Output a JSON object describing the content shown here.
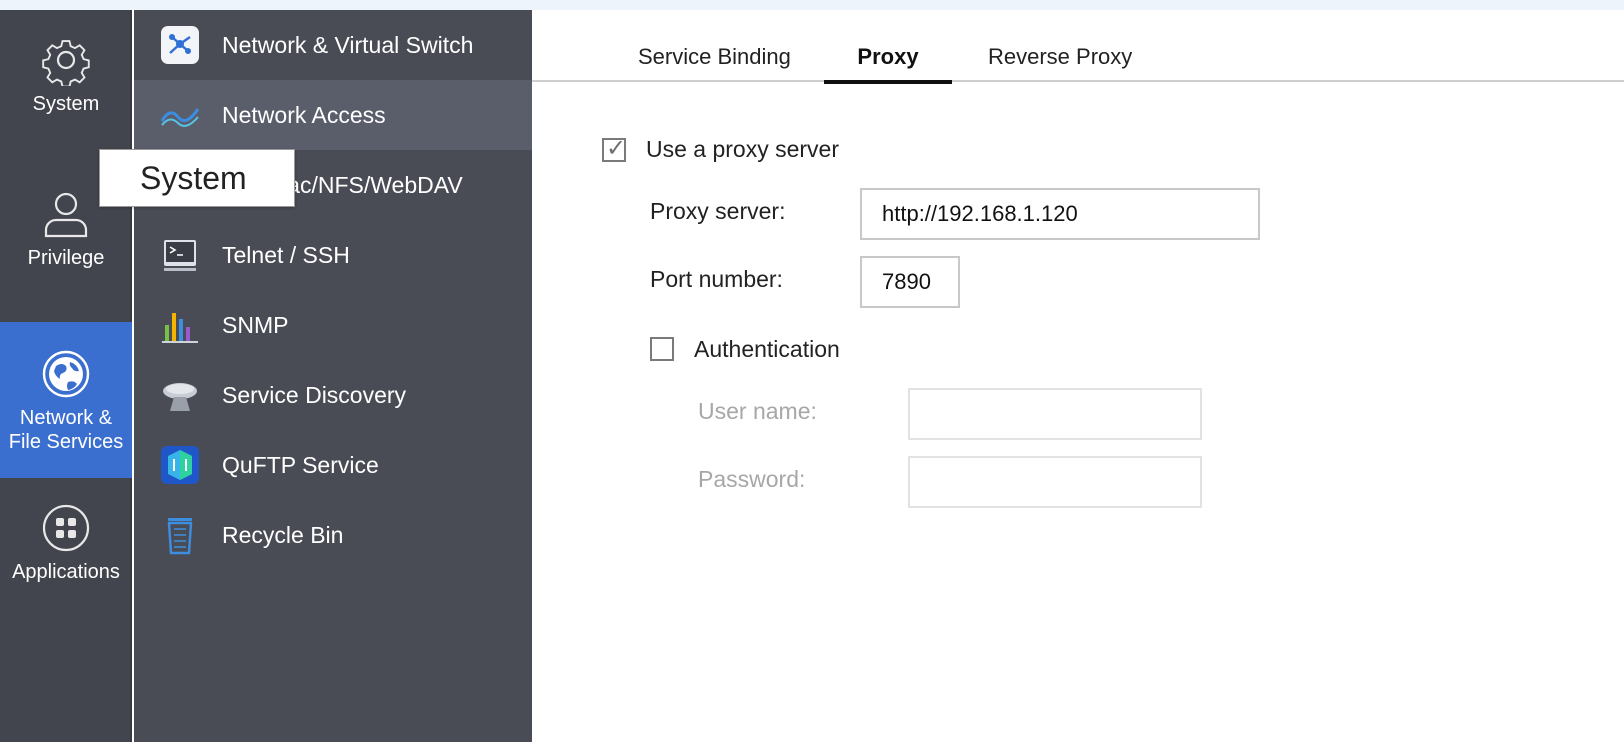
{
  "rail": {
    "items": [
      {
        "label": "System"
      },
      {
        "label": "Privilege"
      },
      {
        "label_line1": "Network &",
        "label_line2": "File Services"
      },
      {
        "label": "Applications"
      }
    ],
    "active_color": "#3a6fd0"
  },
  "submenu": {
    "items": [
      {
        "label": "Network & Virtual Switch"
      },
      {
        "label": "Network Access"
      },
      {
        "label": "Win/Mac/NFS/WebDAV"
      },
      {
        "label": "Telnet / SSH"
      },
      {
        "label": "SNMP"
      },
      {
        "label": "Service Discovery"
      },
      {
        "label": "QuFTP Service"
      },
      {
        "label": "Recycle Bin"
      }
    ]
  },
  "tooltip": {
    "text": "System"
  },
  "tabs": [
    {
      "label": "Service Binding"
    },
    {
      "label": "Proxy"
    },
    {
      "label": "Reverse Proxy"
    }
  ],
  "form": {
    "use_proxy_label": "Use a proxy server",
    "use_proxy_checked": true,
    "proxy_server_label": "Proxy server:",
    "proxy_server_value": "http://192.168.1.120",
    "port_label": "Port number:",
    "port_value": "7890",
    "auth_label": "Authentication",
    "auth_checked": false,
    "username_label": "User name:",
    "username_value": "",
    "password_label": "Password:",
    "password_value": ""
  }
}
